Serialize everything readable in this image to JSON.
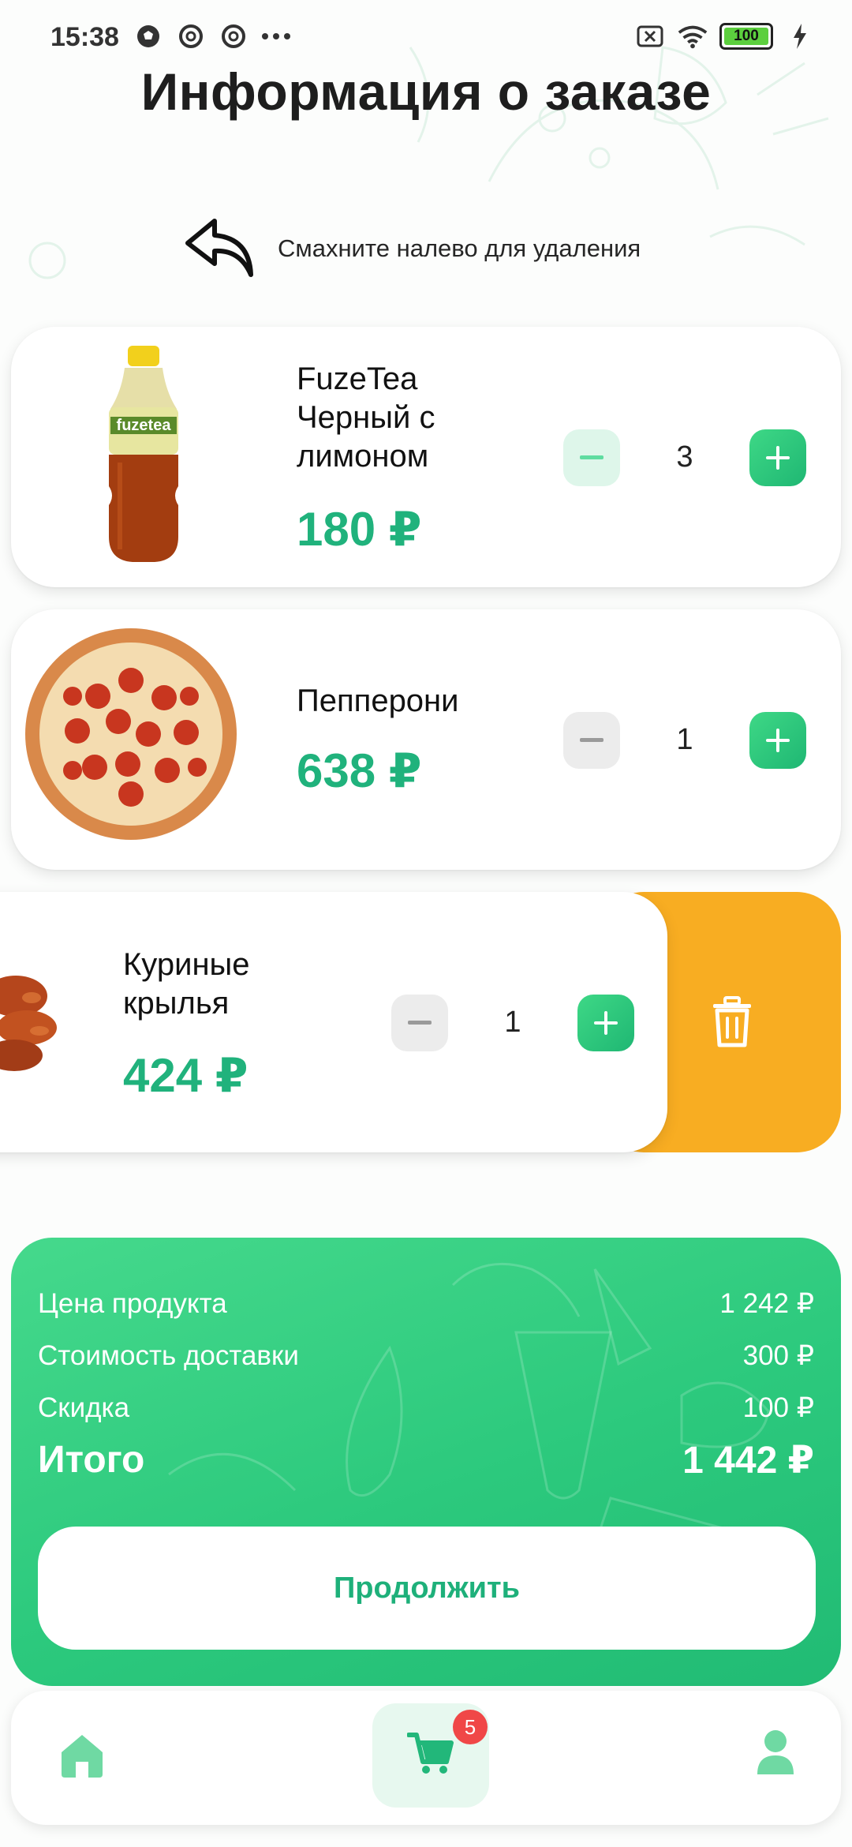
{
  "status_bar": {
    "time": "15:38",
    "battery_level": "100"
  },
  "title": "Информация о заказе",
  "swipe_hint": "Смахните налево для удаления",
  "items": [
    {
      "name": "FuzeTea\nЧерный с\nлимоном",
      "price": "180 ₽",
      "quantity": "3",
      "image": "tea-bottle-image"
    },
    {
      "name": "Пепперони",
      "price": "638 ₽",
      "quantity": "1",
      "image": "pizza-image"
    },
    {
      "name": "Куриные\nкрылья",
      "price": "424 ₽",
      "quantity": "1",
      "image": "chicken-wings-image"
    }
  ],
  "summary": {
    "product_price_label": "Цена продукта",
    "product_price_value": "1 242 ₽",
    "delivery_label": "Стоимость доставки",
    "delivery_value": "300 ₽",
    "discount_label": "Скидка",
    "discount_value": "100 ₽",
    "total_label": "Итого",
    "total_value": "1 442 ₽",
    "continue_label": "Продолжить"
  },
  "bottom_nav": {
    "cart_badge": "5",
    "items": [
      "home-icon",
      "cart-icon",
      "profile-icon"
    ]
  },
  "colors": {
    "accent": "#20b27c",
    "delete": "#f8ad22",
    "badge": "#f04747"
  }
}
